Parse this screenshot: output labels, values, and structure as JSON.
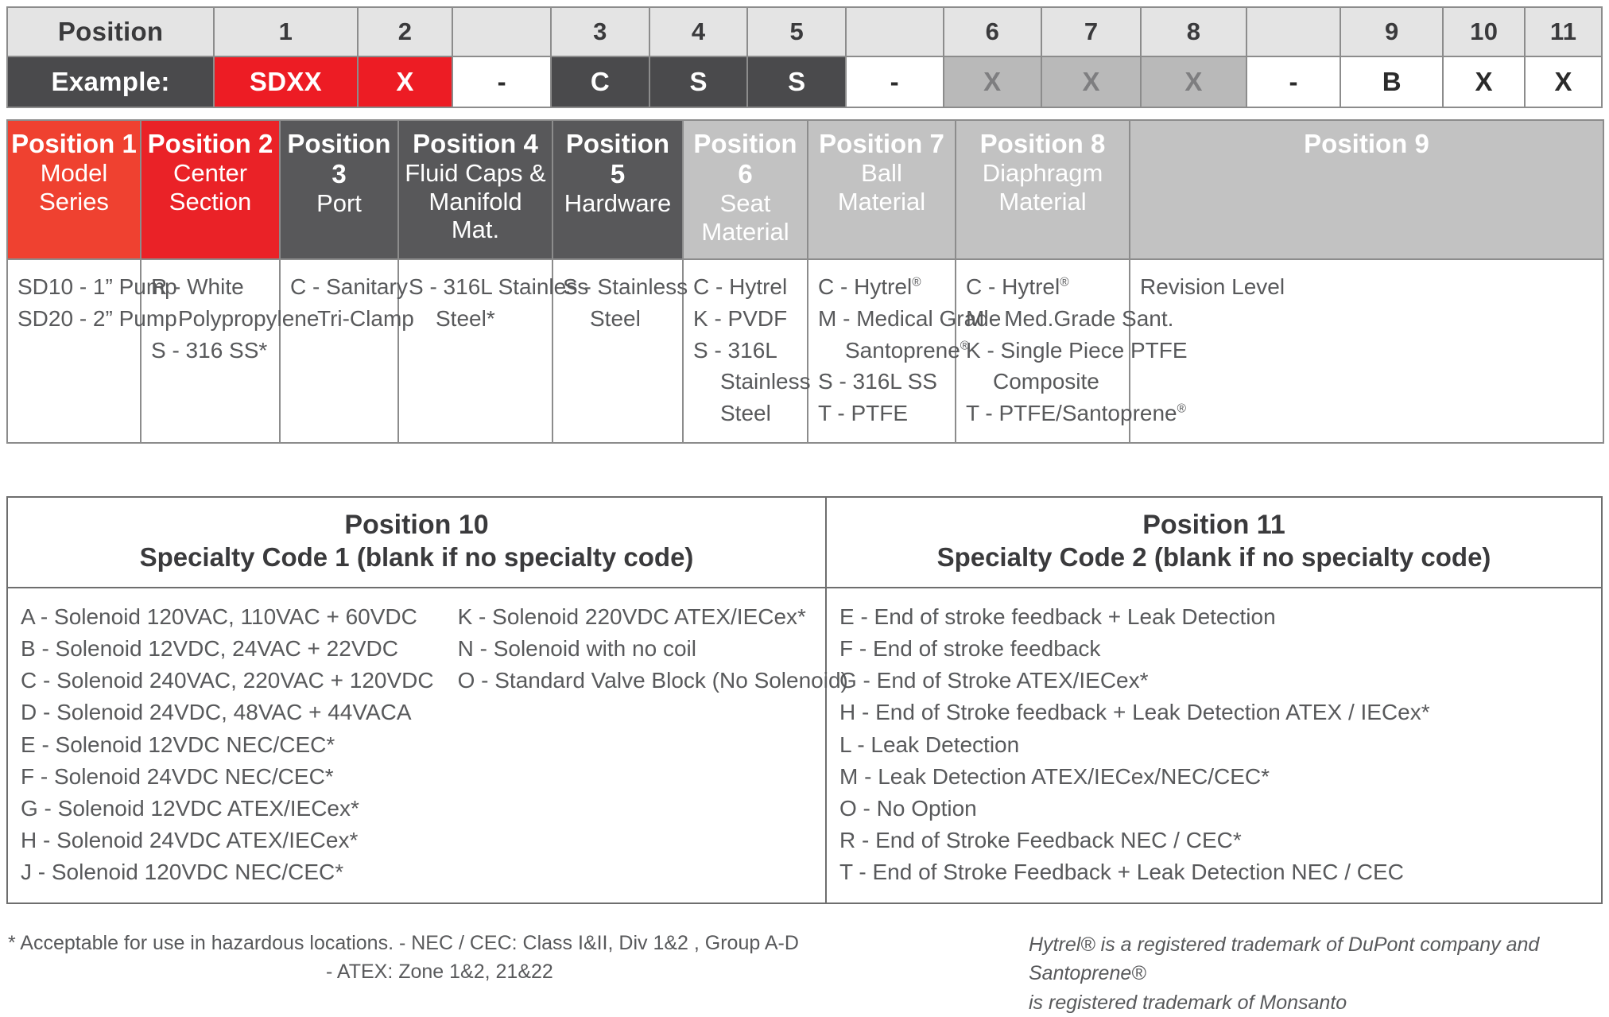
{
  "strip": {
    "position_label": "Position",
    "example_label": "Example:",
    "positions": [
      "1",
      "2",
      "",
      "3",
      "4",
      "5",
      "",
      "6",
      "7",
      "8",
      "",
      "9",
      "10",
      "11"
    ],
    "example": [
      "SDXX",
      "X",
      "-",
      "C",
      "S",
      "S",
      "-",
      "X",
      "X",
      "X",
      "-",
      "B",
      "X",
      "X"
    ]
  },
  "main_table": {
    "columns": [
      {
        "header_line1": "Position 1",
        "header_line2": "Model",
        "header_line3": "Series",
        "style": "red1",
        "options": [
          {
            "text": "SD10 - 1” Pump",
            "indent": false
          },
          {
            "text": "SD20 - 2” Pump",
            "indent": false
          }
        ]
      },
      {
        "header_line1": "Position 2",
        "header_line2": "Center",
        "header_line3": "Section",
        "style": "red2",
        "options": [
          {
            "text": "R - White",
            "indent": false
          },
          {
            "text": "Polypropylene",
            "indent": true
          },
          {
            "text": "S - 316 SS*",
            "indent": false
          }
        ]
      },
      {
        "header_line1": "Position 3",
        "header_line2": "",
        "header_line3": "Port",
        "style": "dark",
        "options": [
          {
            "text": "C - Sanitary",
            "indent": false
          },
          {
            "text": "Tri-Clamp",
            "indent": true
          }
        ]
      },
      {
        "header_line1": "Position 4",
        "header_line2": "Fluid Caps &",
        "header_line3": "Manifold Mat.",
        "style": "dark",
        "options": [
          {
            "text": "S - 316L Stainless",
            "indent": false
          },
          {
            "text": "Steel*",
            "indent": true
          }
        ]
      },
      {
        "header_line1": "Position 5",
        "header_line2": "",
        "header_line3": "Hardware",
        "style": "dark",
        "options": [
          {
            "text": "S - Stainless",
            "indent": false
          },
          {
            "text": "Steel",
            "indent": true
          }
        ]
      },
      {
        "header_line1": "Position 6",
        "header_line2": "Seat",
        "header_line3": "Material",
        "style": "light",
        "options": [
          {
            "text": "C - Hytrel",
            "indent": false
          },
          {
            "text": "K - PVDF",
            "indent": false
          },
          {
            "text": "S - 316L",
            "indent": false
          },
          {
            "text": "Stainless",
            "indent": true
          },
          {
            "text": "Steel",
            "indent": true
          }
        ]
      },
      {
        "header_line1": "Position 7",
        "header_line2": "Ball",
        "header_line3": "Material",
        "style": "light",
        "options": [
          {
            "text": "C - Hytrel",
            "reg": true,
            "indent": false
          },
          {
            "text": "M - Medical Grade",
            "indent": false
          },
          {
            "text": "Santoprene",
            "reg": true,
            "indent": true
          },
          {
            "text": "S - 316L SS",
            "indent": false
          },
          {
            "text": "T - PTFE",
            "indent": false
          }
        ]
      },
      {
        "header_line1": "Position 8",
        "header_line2": "Diaphragm",
        "header_line3": "Material",
        "style": "light",
        "options": [
          {
            "text": "C - Hytrel",
            "reg": true,
            "indent": false
          },
          {
            "text": "M - Med.Grade Sant.",
            "indent": false
          },
          {
            "text": "K - Single Piece PTFE",
            "indent": false
          },
          {
            "text": "Composite",
            "indent": true
          },
          {
            "text": "T - PTFE/Santoprene",
            "reg": true,
            "indent": false
          }
        ]
      },
      {
        "header_line1": "Position 9",
        "header_line2": "",
        "header_line3": "",
        "style": "light",
        "options": [
          {
            "text": "Revision Level",
            "indent": false
          }
        ]
      }
    ]
  },
  "specialty": {
    "position10": {
      "title": "Position 10",
      "subtitle": "Specialty Code 1 (blank if no specialty code)",
      "column_a": [
        "A - Solenoid 120VAC, 110VAC + 60VDC",
        "B - Solenoid 12VDC, 24VAC + 22VDC",
        "C - Solenoid 240VAC, 220VAC + 120VDC",
        "D - Solenoid 24VDC, 48VAC + 44VACA",
        "E - Solenoid 12VDC NEC/CEC*",
        "F - Solenoid 24VDC NEC/CEC*",
        "G - Solenoid 12VDC ATEX/IECex*",
        "H - Solenoid 24VDC ATEX/IECex*",
        "J - Solenoid 120VDC NEC/CEC*"
      ],
      "column_b": [
        "K - Solenoid 220VDC ATEX/IECex*",
        "N - Solenoid with no coil",
        "O - Standard Valve Block (No Solenoid)"
      ]
    },
    "position11": {
      "title": "Position 11",
      "subtitle": "Specialty Code 2 (blank if no specialty code)",
      "options": [
        "E - End of stroke feedback + Leak Detection",
        "F - End of stroke feedback",
        "G - End of Stroke ATEX/IECex*",
        "H - End of Stroke feedback + Leak Detection ATEX / IECex*",
        "L - Leak Detection",
        "M - Leak Detection ATEX/IECex/NEC/CEC*",
        "O - No Option",
        "R - End of Stroke Feedback NEC / CEC*",
        "T - End of Stroke Feedback + Leak Detection NEC / CEC"
      ]
    }
  },
  "footnotes": {
    "left_line1": "* Acceptable for use in hazardous locations.  - NEC / CEC: Class I&II, Div 1&2 , Group A-D",
    "left_line2": "- ATEX: Zone 1&2, 21&22",
    "right_line1": "Hytrel® is a registered trademark of DuPont company and Santoprene®",
    "right_line2": "is registered trademark of Monsanto"
  }
}
